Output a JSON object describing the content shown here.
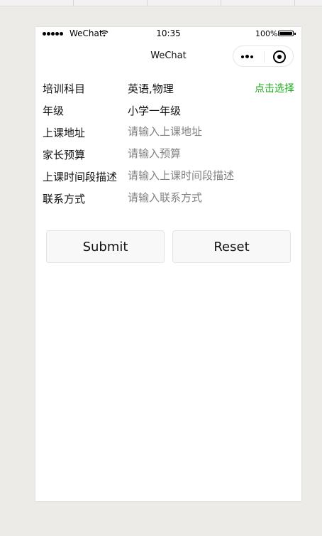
{
  "status_bar": {
    "carrier": "WeChat",
    "time": "10:35",
    "battery": "100%"
  },
  "nav": {
    "title": "WeChat"
  },
  "form": {
    "rows": [
      {
        "label": "培训科目",
        "value": "英语,物理",
        "action": "点击选择"
      },
      {
        "label": "年级",
        "value": "小学一年级"
      },
      {
        "label": "上课地址",
        "placeholder": "请输入上课地址"
      },
      {
        "label": "家长预算",
        "placeholder": "请输入预算"
      },
      {
        "label": "上课时间段描述",
        "placeholder": "请输入上课时间段描述"
      },
      {
        "label": "联系方式",
        "placeholder": "请输入联系方式"
      }
    ]
  },
  "buttons": {
    "submit": "Submit",
    "reset": "Reset"
  },
  "colors": {
    "accent": "#1aad19",
    "background": "#edebe8",
    "placeholder": "#808080"
  }
}
